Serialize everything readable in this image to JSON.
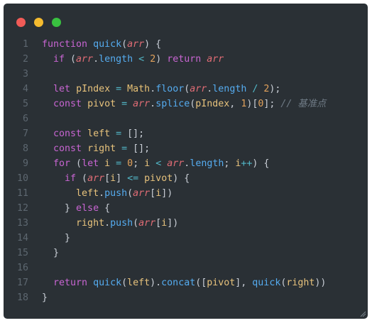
{
  "window": {
    "background": "#2a3035",
    "controls": [
      {
        "name": "close",
        "color": "#f15b57"
      },
      {
        "name": "minimize",
        "color": "#f5bb2f"
      },
      {
        "name": "zoom",
        "color": "#39c140"
      }
    ]
  },
  "theme": {
    "kw": "#c865d2",
    "fn": "#55acf0",
    "param": "#e06c75",
    "var": "#e7c27c",
    "num": "#e2a25c",
    "op": "#52b8c8",
    "punc": "#c9ced6",
    "comment": "#6f7a85",
    "obj": "#e6c074"
  },
  "code": {
    "lines": [
      {
        "n": "1",
        "tokens": [
          [
            "function",
            "kw"
          ],
          [
            " ",
            "punc"
          ],
          [
            "quick",
            "fn"
          ],
          [
            "(",
            "punc"
          ],
          [
            "arr",
            "param"
          ],
          [
            ") {",
            "punc"
          ]
        ]
      },
      {
        "n": "2",
        "tokens": [
          [
            "  ",
            "punc"
          ],
          [
            "if",
            "kw"
          ],
          [
            " (",
            "punc"
          ],
          [
            "arr",
            "param"
          ],
          [
            ".",
            "punc"
          ],
          [
            "length",
            "fn"
          ],
          [
            " ",
            "punc"
          ],
          [
            "<",
            "op"
          ],
          [
            " ",
            "punc"
          ],
          [
            "2",
            "num"
          ],
          [
            ") ",
            "punc"
          ],
          [
            "return",
            "kw"
          ],
          [
            " ",
            "punc"
          ],
          [
            "arr",
            "param"
          ]
        ]
      },
      {
        "n": "3",
        "tokens": []
      },
      {
        "n": "4",
        "tokens": [
          [
            "  ",
            "punc"
          ],
          [
            "let",
            "kw"
          ],
          [
            " ",
            "punc"
          ],
          [
            "pIndex",
            "var"
          ],
          [
            " ",
            "punc"
          ],
          [
            "=",
            "op"
          ],
          [
            " ",
            "punc"
          ],
          [
            "Math",
            "obj"
          ],
          [
            ".",
            "punc"
          ],
          [
            "floor",
            "fn"
          ],
          [
            "(",
            "punc"
          ],
          [
            "arr",
            "param"
          ],
          [
            ".",
            "punc"
          ],
          [
            "length",
            "fn"
          ],
          [
            " ",
            "punc"
          ],
          [
            "/",
            "op"
          ],
          [
            " ",
            "punc"
          ],
          [
            "2",
            "num"
          ],
          [
            ");",
            "punc"
          ]
        ]
      },
      {
        "n": "5",
        "tokens": [
          [
            "  ",
            "punc"
          ],
          [
            "const",
            "kw"
          ],
          [
            " ",
            "punc"
          ],
          [
            "pivot",
            "var"
          ],
          [
            " ",
            "punc"
          ],
          [
            "=",
            "op"
          ],
          [
            " ",
            "punc"
          ],
          [
            "arr",
            "param"
          ],
          [
            ".",
            "punc"
          ],
          [
            "splice",
            "fn"
          ],
          [
            "(",
            "punc"
          ],
          [
            "pIndex",
            "var"
          ],
          [
            ", ",
            "punc"
          ],
          [
            "1",
            "num"
          ],
          [
            ")[",
            "punc"
          ],
          [
            "0",
            "num"
          ],
          [
            "]; ",
            "punc"
          ],
          [
            "// 基准点",
            "comment"
          ]
        ]
      },
      {
        "n": "6",
        "tokens": []
      },
      {
        "n": "7",
        "tokens": [
          [
            "  ",
            "punc"
          ],
          [
            "const",
            "kw"
          ],
          [
            " ",
            "punc"
          ],
          [
            "left",
            "var"
          ],
          [
            " ",
            "punc"
          ],
          [
            "=",
            "op"
          ],
          [
            " [];",
            "punc"
          ]
        ]
      },
      {
        "n": "8",
        "tokens": [
          [
            "  ",
            "punc"
          ],
          [
            "const",
            "kw"
          ],
          [
            " ",
            "punc"
          ],
          [
            "right",
            "var"
          ],
          [
            " ",
            "punc"
          ],
          [
            "=",
            "op"
          ],
          [
            " [];",
            "punc"
          ]
        ]
      },
      {
        "n": "9",
        "tokens": [
          [
            "  ",
            "punc"
          ],
          [
            "for",
            "kw"
          ],
          [
            " (",
            "punc"
          ],
          [
            "let",
            "kw"
          ],
          [
            " ",
            "punc"
          ],
          [
            "i",
            "var"
          ],
          [
            " ",
            "punc"
          ],
          [
            "=",
            "op"
          ],
          [
            " ",
            "punc"
          ],
          [
            "0",
            "num"
          ],
          [
            "; ",
            "punc"
          ],
          [
            "i",
            "var"
          ],
          [
            " ",
            "punc"
          ],
          [
            "<",
            "op"
          ],
          [
            " ",
            "punc"
          ],
          [
            "arr",
            "param"
          ],
          [
            ".",
            "punc"
          ],
          [
            "length",
            "fn"
          ],
          [
            "; ",
            "punc"
          ],
          [
            "i",
            "var"
          ],
          [
            "++",
            "op"
          ],
          [
            ") {",
            "punc"
          ]
        ]
      },
      {
        "n": "10",
        "tokens": [
          [
            "    ",
            "punc"
          ],
          [
            "if",
            "kw"
          ],
          [
            " (",
            "punc"
          ],
          [
            "arr",
            "param"
          ],
          [
            "[",
            "punc"
          ],
          [
            "i",
            "var"
          ],
          [
            "] ",
            "punc"
          ],
          [
            "<=",
            "op"
          ],
          [
            " ",
            "punc"
          ],
          [
            "pivot",
            "var"
          ],
          [
            ") {",
            "punc"
          ]
        ]
      },
      {
        "n": "11",
        "tokens": [
          [
            "      ",
            "punc"
          ],
          [
            "left",
            "var"
          ],
          [
            ".",
            "punc"
          ],
          [
            "push",
            "fn"
          ],
          [
            "(",
            "punc"
          ],
          [
            "arr",
            "param"
          ],
          [
            "[",
            "punc"
          ],
          [
            "i",
            "var"
          ],
          [
            "])",
            "punc"
          ]
        ]
      },
      {
        "n": "12",
        "tokens": [
          [
            "    } ",
            "punc"
          ],
          [
            "else",
            "kw"
          ],
          [
            " {",
            "punc"
          ]
        ]
      },
      {
        "n": "13",
        "tokens": [
          [
            "      ",
            "punc"
          ],
          [
            "right",
            "var"
          ],
          [
            ".",
            "punc"
          ],
          [
            "push",
            "fn"
          ],
          [
            "(",
            "punc"
          ],
          [
            "arr",
            "param"
          ],
          [
            "[",
            "punc"
          ],
          [
            "i",
            "var"
          ],
          [
            "])",
            "punc"
          ]
        ]
      },
      {
        "n": "14",
        "tokens": [
          [
            "    }",
            "punc"
          ]
        ]
      },
      {
        "n": "15",
        "tokens": [
          [
            "  }",
            "punc"
          ]
        ]
      },
      {
        "n": "16",
        "tokens": []
      },
      {
        "n": "17",
        "tokens": [
          [
            "  ",
            "punc"
          ],
          [
            "return",
            "kw"
          ],
          [
            " ",
            "punc"
          ],
          [
            "quick",
            "fn"
          ],
          [
            "(",
            "punc"
          ],
          [
            "left",
            "var"
          ],
          [
            ").",
            "punc"
          ],
          [
            "concat",
            "fn"
          ],
          [
            "([",
            "punc"
          ],
          [
            "pivot",
            "var"
          ],
          [
            "], ",
            "punc"
          ],
          [
            "quick",
            "fn"
          ],
          [
            "(",
            "punc"
          ],
          [
            "right",
            "var"
          ],
          [
            "))",
            "punc"
          ]
        ]
      },
      {
        "n": "18",
        "tokens": [
          [
            "}",
            "punc"
          ]
        ]
      }
    ]
  }
}
